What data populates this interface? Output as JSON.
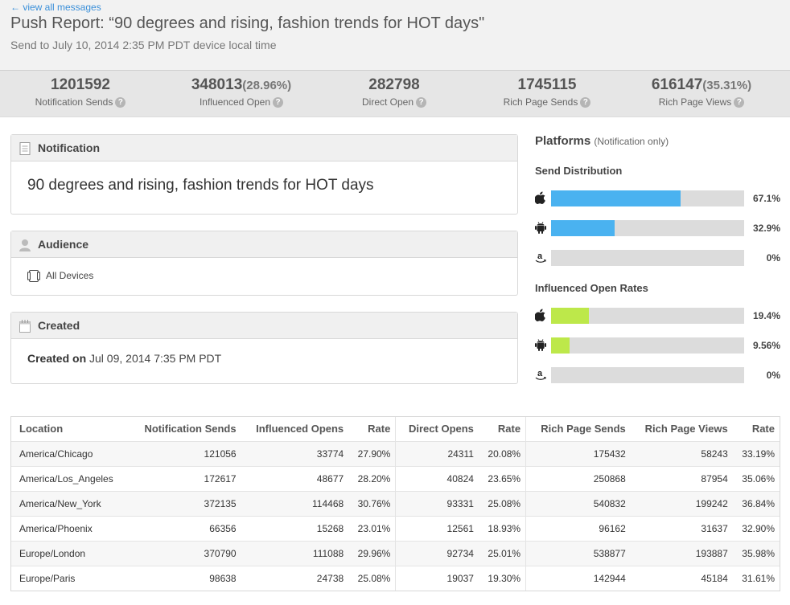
{
  "header": {
    "back_link": "← view all messages",
    "title": "Push Report: “90 degrees and rising, fashion trends for HOT days\"",
    "subtitle": "Send to July 10, 2014 2:35 PM PDT device local time"
  },
  "stats": [
    {
      "value": "1201592",
      "pct": "",
      "label": "Notification Sends"
    },
    {
      "value": "348013",
      "pct": "(28.96%)",
      "label": "Influenced Open"
    },
    {
      "value": "282798",
      "pct": "",
      "label": "Direct Open"
    },
    {
      "value": "1745115",
      "pct": "",
      "label": "Rich Page Sends"
    },
    {
      "value": "616147",
      "pct": "(35.31%)",
      "label": "Rich Page Views"
    }
  ],
  "help_glyph": "?",
  "notification": {
    "title": "Notification",
    "text": "90 degrees and rising, fashion trends for HOT days"
  },
  "audience": {
    "title": "Audience",
    "text": "All Devices"
  },
  "created": {
    "title": "Created",
    "label": "Created on",
    "value": "Jul 09, 2014 7:35 PM PDT"
  },
  "platforms": {
    "title": "Platforms",
    "subtitle": "(Notification only)",
    "send_distribution": {
      "title": "Send Distribution",
      "color": "#4ab2f0",
      "rows": [
        {
          "os": "apple-icon",
          "value": 67.1,
          "label": "67.1%"
        },
        {
          "os": "android-icon",
          "value": 32.9,
          "label": "32.9%"
        },
        {
          "os": "amazon-icon",
          "value": 0,
          "label": "0%"
        }
      ]
    },
    "influenced_open_rates": {
      "title": "Influenced Open Rates",
      "color": "#bde84a",
      "rows": [
        {
          "os": "apple-icon",
          "value": 19.4,
          "label": "19.4%"
        },
        {
          "os": "android-icon",
          "value": 9.56,
          "label": "9.56%"
        },
        {
          "os": "amazon-icon",
          "value": 0,
          "label": "0%"
        }
      ]
    }
  },
  "table": {
    "headers": [
      "Location",
      "Notification Sends",
      "Influenced Opens",
      "Rate",
      "Direct Opens",
      "Rate",
      "Rich Page Sends",
      "Rich Page Views",
      "Rate"
    ],
    "rows": [
      [
        "America/Chicago",
        "121056",
        "33774",
        "27.90%",
        "24311",
        "20.08%",
        "175432",
        "58243",
        "33.19%"
      ],
      [
        "America/Los_Angeles",
        "172617",
        "48677",
        "28.20%",
        "40824",
        "23.65%",
        "250868",
        "87954",
        "35.06%"
      ],
      [
        "America/New_York",
        "372135",
        "114468",
        "30.76%",
        "93331",
        "25.08%",
        "540832",
        "199242",
        "36.84%"
      ],
      [
        "America/Phoenix",
        "66356",
        "15268",
        "23.01%",
        "12561",
        "18.93%",
        "96162",
        "31637",
        "32.90%"
      ],
      [
        "Europe/London",
        "370790",
        "111088",
        "29.96%",
        "92734",
        "25.01%",
        "538877",
        "193887",
        "35.98%"
      ],
      [
        "Europe/Paris",
        "98638",
        "24738",
        "25.08%",
        "19037",
        "19.30%",
        "142944",
        "45184",
        "31.61%"
      ]
    ]
  }
}
